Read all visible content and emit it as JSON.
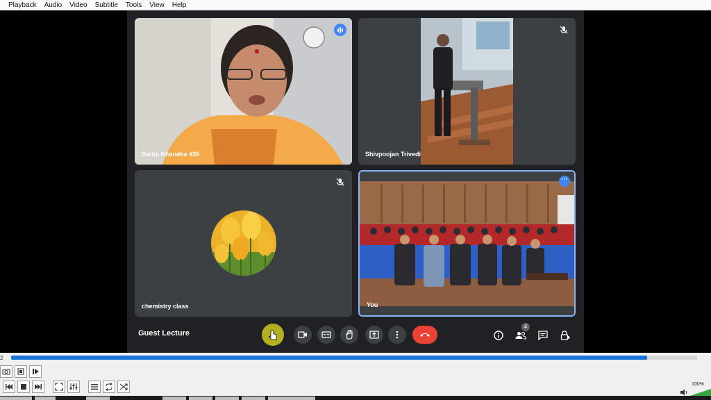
{
  "menu": [
    "Playback",
    "Audio",
    "Video",
    "Subtitle",
    "Tools",
    "View",
    "Help"
  ],
  "meeting": {
    "title": "Guest Lecture",
    "participant_count": "4",
    "participants": [
      {
        "name": "Sarita Khandka 436"
      },
      {
        "name": "Shivpoojan Trivedi"
      },
      {
        "name": "chemistry class"
      },
      {
        "name": "You"
      }
    ]
  },
  "player": {
    "time_left": "2",
    "volume": "100%",
    "progress": 0.927
  },
  "colors": {
    "meet_bg": "#202124",
    "tile_bg": "#3c4043",
    "accent_blue": "#4285f4",
    "end_call_red": "#ea4335",
    "seek_fill": "#1a73d9"
  }
}
